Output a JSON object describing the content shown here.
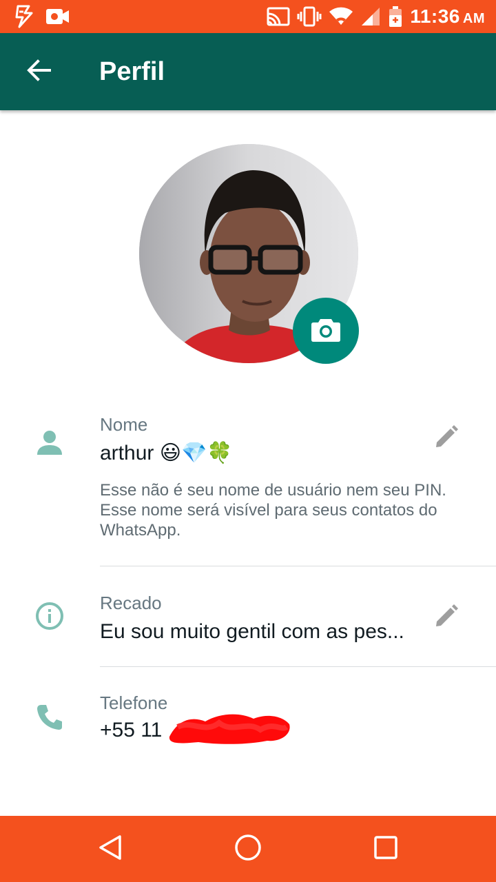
{
  "status_bar": {
    "time": "11:36",
    "ampm": "AM",
    "icons": [
      "bolt-icon",
      "video-icon",
      "cast-icon",
      "vibrate-icon",
      "wifi-icon",
      "signal-icon",
      "battery-icon"
    ]
  },
  "app_bar": {
    "title": "Perfil",
    "back_icon": "arrow-back-icon"
  },
  "profile": {
    "camera_icon": "camera-icon"
  },
  "name_row": {
    "label": "Nome",
    "value": "arthur 😃💎🍀",
    "hint": "Esse não é seu nome de usuário nem seu PIN. Esse nome será visível para seus contatos do WhatsApp.",
    "icon": "person-icon",
    "edit_icon": "pencil-icon"
  },
  "about_row": {
    "label": "Recado",
    "value": "Eu sou muito gentil com as pes...",
    "icon": "info-icon",
    "edit_icon": "pencil-icon"
  },
  "phone_row": {
    "label": "Telefone",
    "value": "+55 11",
    "icon": "phone-icon"
  },
  "colors": {
    "status_bar": "#f4511e",
    "app_bar": "#075e54",
    "accent": "#00897b",
    "row_icon": "#7fbfb3",
    "redaction": "#ff0000"
  }
}
